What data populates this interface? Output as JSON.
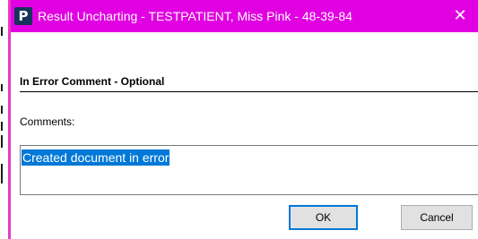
{
  "window": {
    "app_icon_letter": "P",
    "title": "Result Uncharting - TESTPATIENT, Miss Pink - 48-39-84",
    "close_glyph": "✕"
  },
  "form": {
    "section_title": "In Error Comment - Optional",
    "comments_label": "Comments:",
    "comments_value": "Created document in error"
  },
  "buttons": {
    "ok_label": "OK",
    "cancel_label": "Cancel"
  },
  "colors": {
    "titlebar": "#e100e1",
    "selection": "#0078d7",
    "icon_bg": "#16345c"
  }
}
